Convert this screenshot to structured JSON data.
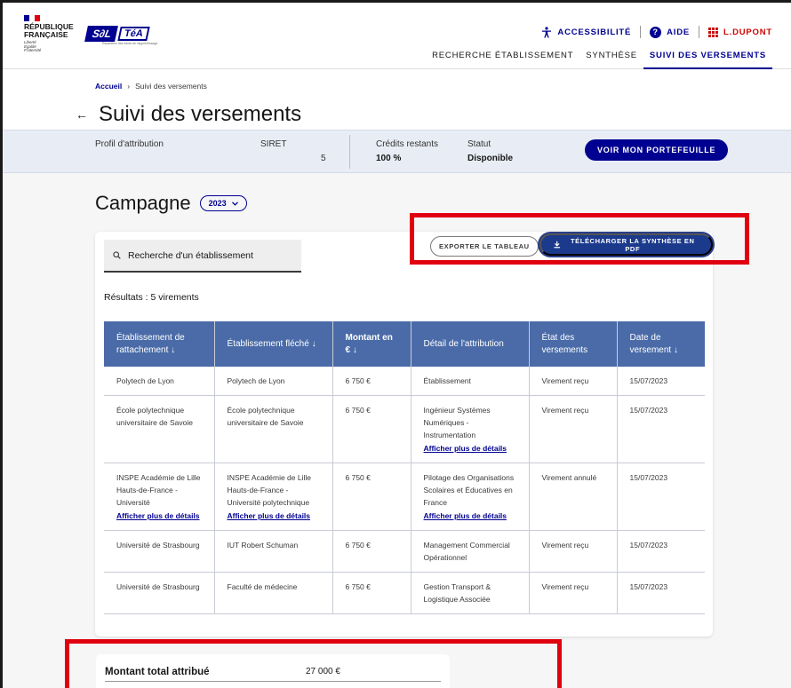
{
  "header": {
    "republic": [
      "RÉPUBLIQUE",
      "FRANÇAISE"
    ],
    "motto": [
      "Liberté",
      "Égalité",
      "Fraternité"
    ],
    "logo_sel": "S∂L",
    "logo_tea": "TéA",
    "logo_tagline": "Répartition des fonds de l'apprentissage",
    "accessibility": "ACCESSIBILITÉ",
    "help": "AIDE",
    "user": "L.DUPONT",
    "colors": {
      "primary": "#000091",
      "alert": "#ce0500"
    }
  },
  "nav": {
    "items": [
      {
        "label": "RECHERCHE ÉTABLISSEMENT",
        "active": false
      },
      {
        "label": "SYNTHÈSE",
        "active": false
      },
      {
        "label": "SUIVI DES VERSEMENTS",
        "active": true
      }
    ]
  },
  "breadcrumb": {
    "home": "Accueil",
    "current": "Suivi des versements"
  },
  "page": {
    "title": "Suivi des versements"
  },
  "info": {
    "profil_label": "Profil d'attribution",
    "siret_label": "SIRET",
    "siret_value": "5",
    "credits_label": "Crédits restants",
    "credits_value": "100 %",
    "status_label": "Statut",
    "status_value": "Disponible",
    "wallet_button": "VOIR MON PORTEFEUILLE"
  },
  "campaign": {
    "label": "Campagne",
    "year": "2023"
  },
  "actions": {
    "search_placeholder": "Recherche d'un établissement",
    "export": "EXPORTER LE TABLEAU",
    "pdf": "TÉLÉCHARGER LA SYNTHÈSE EN PDF"
  },
  "results": "Résultats : 5 virements",
  "table": {
    "headers": [
      "Établissement de rattachement",
      "Établissement fléché",
      "Montant en €",
      "Détail de l'attribution",
      "État des versements",
      "Date de versement"
    ],
    "link_label": "Afficher plus de détails",
    "rows": [
      {
        "rattachement": "Polytech de Lyon",
        "fleche": "Polytech de Lyon",
        "montant": "6 750 €",
        "detail": "Établissement",
        "etat": "Virement reçu",
        "date": "15/07/2023"
      },
      {
        "rattachement": "École polytechnique universitaire de Savoie",
        "fleche": "École polytechnique universitaire de Savoie",
        "montant": "6 750 €",
        "detail": "Ingénieur Systèmes Numériques - Instrumentation",
        "etat": "Virement reçu",
        "date": "15/07/2023"
      },
      {
        "rattachement": "INSPE Académie de Lille Hauts-de-France - Université",
        "fleche": "INSPE Académie de Lille Hauts-de-France - Université polytechnique",
        "montant": "6 750 €",
        "detail": "Pilotage des Organisations Scolaires et Éducatives en France",
        "etat": "Virement annulé",
        "date": "15/07/2023"
      },
      {
        "rattachement": "Université de Strasbourg",
        "fleche": "IUT Robert Schuman",
        "montant": "6 750 €",
        "detail": "Management Commercial Opérationnel",
        "etat": "Virement reçu",
        "date": "15/07/2023"
      },
      {
        "rattachement": "Université de Strasbourg",
        "fleche": "Faculté de médecine",
        "montant": "6 750 €",
        "detail": "Gestion Transport & Logistique Associée",
        "etat": "Virement reçu",
        "date": "15/07/2023"
      }
    ]
  },
  "total": {
    "label": "Montant total attribué",
    "value": "27 000 €"
  }
}
